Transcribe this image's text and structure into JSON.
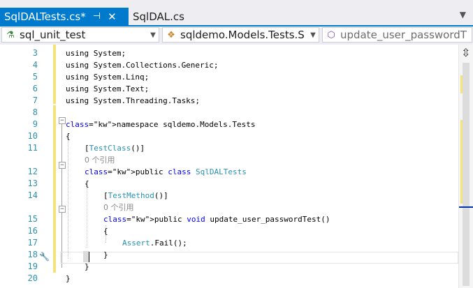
{
  "tabs": [
    {
      "label": "SqlDALTests.cs*",
      "pin": "⊣",
      "close": "✕",
      "active": true
    },
    {
      "label": "SqlDAL.cs",
      "active": false
    }
  ],
  "tab_scroll_icon": "chevron-down-icon",
  "navbar": {
    "project": {
      "icon": "test-project-icon",
      "text": "sql_unit_test"
    },
    "class": {
      "icon": "class-icon",
      "text": "sqldemo.Models.Tests.S"
    },
    "member": {
      "icon": "method-icon",
      "text": "update_user_passwordT"
    }
  },
  "editor": {
    "lines": [
      {
        "num": "3",
        "text": "using System;"
      },
      {
        "num": "4",
        "text": "using System.Collections.Generic;"
      },
      {
        "num": "5",
        "text": "using System.Linq;"
      },
      {
        "num": "6",
        "text": "using System.Text;"
      },
      {
        "num": "7",
        "text": "using System.Threading.Tasks;"
      },
      {
        "num": "8",
        "text": ""
      },
      {
        "num": "9",
        "text": "namespace sqldemo.Models.Tests"
      },
      {
        "num": "10",
        "text": "{"
      },
      {
        "num": "11",
        "text": "[TestClass()]"
      },
      {
        "num": "",
        "text": "0 个引用"
      },
      {
        "num": "12",
        "text": "public class SqlDALTests"
      },
      {
        "num": "13",
        "text": "{"
      },
      {
        "num": "14",
        "text": "[TestMethod()]"
      },
      {
        "num": "",
        "text": "0 个引用"
      },
      {
        "num": "15",
        "text": "public void update_user_passwordTest()"
      },
      {
        "num": "16",
        "text": "{"
      },
      {
        "num": "17",
        "text": "Assert.Fail();"
      },
      {
        "num": "18",
        "text": "}"
      },
      {
        "num": "19",
        "text": "}"
      },
      {
        "num": "20",
        "text": "}"
      }
    ]
  },
  "colors": {
    "accent": "#007acc",
    "keyword": "#0000ff",
    "type": "#2b91af",
    "changed": "#f6e27a"
  }
}
